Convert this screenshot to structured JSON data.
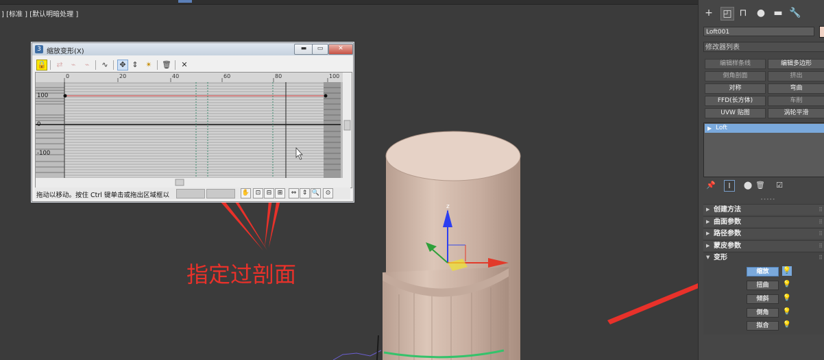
{
  "viewport": {
    "label": "] [标准 ] [默认明暗处理 ]"
  },
  "dialog": {
    "title": "缩放变形(X)",
    "app_icon": "3",
    "minimize": "▬",
    "maximize": "▭",
    "close": "✕",
    "ruler_labels": [
      "0",
      "20",
      "40",
      "60",
      "80",
      "100"
    ],
    "y_labels": [
      "100",
      "0",
      "-100"
    ],
    "status_text": "拖动以移动。按住 Ctrl 键单击或拖出区域框以"
  },
  "annotation": {
    "text": "指定过剖面"
  },
  "panel": {
    "object_name": "Loft001",
    "object_color": "#f0d2c4",
    "modifier_list_label": "修改器列表",
    "modifier_buttons": [
      {
        "label": "编辑样条线",
        "enabled": false
      },
      {
        "label": "编辑多边形",
        "enabled": true
      },
      {
        "label": "倒角剖面",
        "enabled": false
      },
      {
        "label": "挤出",
        "enabled": false
      },
      {
        "label": "对称",
        "enabled": true
      },
      {
        "label": "弯曲",
        "enabled": true
      },
      {
        "label": "FFD(长方体)",
        "enabled": true
      },
      {
        "label": "车削",
        "enabled": false
      },
      {
        "label": "UVW 贴图",
        "enabled": true
      },
      {
        "label": "涡轮平滑",
        "enabled": true
      }
    ],
    "stack_item": "Loft",
    "rollouts": [
      {
        "label": "创建方法",
        "expanded": false
      },
      {
        "label": "曲面参数",
        "expanded": false
      },
      {
        "label": "路径参数",
        "expanded": false
      },
      {
        "label": "蒙皮参数",
        "expanded": false
      },
      {
        "label": "变形",
        "expanded": true
      }
    ],
    "deform_buttons": [
      {
        "label": "缩放",
        "selected": true
      },
      {
        "label": "扭曲",
        "selected": false
      },
      {
        "label": "倾斜",
        "selected": false
      },
      {
        "label": "倒角",
        "selected": false
      },
      {
        "label": "拟合",
        "selected": false
      }
    ]
  },
  "colors": {
    "accent": "#7aa9dc",
    "annotation": "#e8312a",
    "cylinder": "#d8c1b3"
  }
}
